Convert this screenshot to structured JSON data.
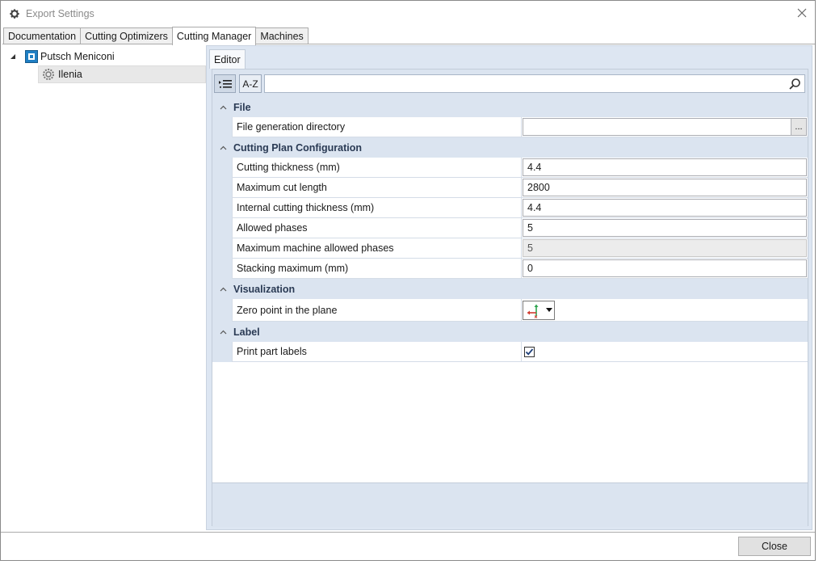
{
  "window": {
    "title": "Export Settings"
  },
  "tabs": [
    "Documentation",
    "Cutting Optimizers",
    "Cutting Manager",
    "Machines"
  ],
  "tree": {
    "root": "Putsch Meniconi",
    "child": "Ilenia"
  },
  "editor": {
    "tab_label": "Editor",
    "toolbar": {
      "az_label": "A-Z",
      "search_value": ""
    },
    "categories": {
      "file": {
        "title": "File",
        "props": [
          {
            "name": "File generation directory",
            "value": "",
            "button": "..."
          }
        ]
      },
      "cutting": {
        "title": "Cutting Plan Configuration",
        "props": [
          {
            "name": "Cutting thickness (mm)",
            "value": "4.4"
          },
          {
            "name": "Maximum cut length",
            "value": "2800"
          },
          {
            "name": "Internal cutting thickness (mm)",
            "value": "4.4"
          },
          {
            "name": "Allowed phases",
            "value": "5"
          },
          {
            "name": "Maximum machine allowed phases",
            "value": "5"
          },
          {
            "name": "Stacking maximum (mm)",
            "value": "0"
          }
        ]
      },
      "visualization": {
        "title": "Visualization",
        "props": [
          {
            "name": "Zero point in the plane"
          }
        ]
      },
      "label": {
        "title": "Label",
        "props": [
          {
            "name": "Print part labels",
            "checked": true
          }
        ]
      }
    }
  },
  "footer": {
    "close_label": "Close"
  },
  "colors": {
    "accent_panel": "#dde6f2",
    "category_bg": "#dbe4f0"
  }
}
